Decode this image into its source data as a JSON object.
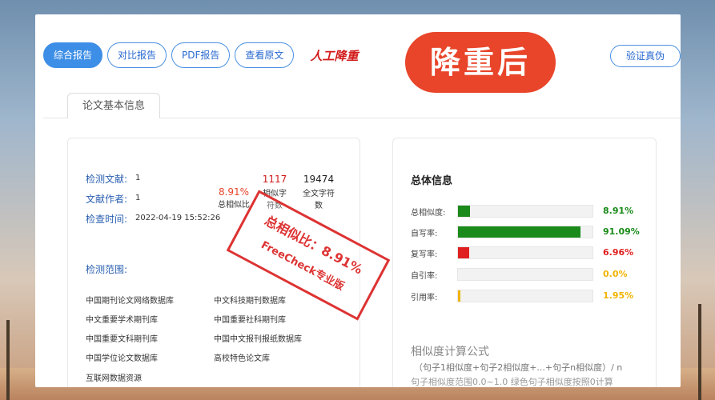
{
  "colors": {
    "accent": "#3d8ee6",
    "green": "#1a8a1a",
    "red": "#e02020",
    "orange": "#f0b400"
  },
  "toolbar": {
    "tabs": [
      {
        "label": "综合报告",
        "active": true
      },
      {
        "label": "对比报告",
        "active": false
      },
      {
        "label": "PDF报告",
        "active": false
      },
      {
        "label": "查看原文",
        "active": false
      }
    ],
    "manual_label": "人工降重",
    "verify_label": "验证真伪"
  },
  "overlay_text": "降重后",
  "section_tab": "论文基本信息",
  "basic": {
    "doc_label": "检测文献:",
    "doc_value": "1",
    "author_label": "文献作者:",
    "author_value": "1",
    "time_label": "检查时间:",
    "time_value": "2022-04-19 15:52:26",
    "similarity_value": "8.91%",
    "similarity_label": "总相似比",
    "similar_chars_value": "1117",
    "similar_chars_label": "相似字符数",
    "total_chars_value": "19474",
    "total_chars_label": "全文字符数"
  },
  "scope": {
    "title": "检测范围:",
    "databases": [
      "中国期刊论文网络数据库",
      "中文科技期刊数据库",
      "中文重要学术期刊库",
      "中国重要社科期刊库",
      "中国重要文科期刊库",
      "中国中文报刊报纸数据库",
      "中国学位论文数据库",
      "高校特色论文库",
      "互联网数据资源"
    ]
  },
  "stamp": {
    "line1": "总相似比：8.91%",
    "line2": "FreeCheck专业版"
  },
  "overall": {
    "title": "总体信息",
    "metrics": [
      {
        "label": "总相似度:",
        "value": "8.91%",
        "fraction": 0.0891,
        "color": "#1a8a1a"
      },
      {
        "label": "自写率:",
        "value": "91.09%",
        "fraction": 0.9109,
        "color": "#1a8a1a"
      },
      {
        "label": "复写率:",
        "value": "6.96%",
        "fraction": 0.0696,
        "color": "#e02020"
      },
      {
        "label": "自引率:",
        "value": "0.0%",
        "fraction": 0.0,
        "color": "#f0b400"
      },
      {
        "label": "引用率:",
        "value": "1.95%",
        "fraction": 0.0195,
        "color": "#f0b400"
      }
    ],
    "formula_title": "相似度计算公式",
    "formula_line1": "（句子1相似度+句子2相似度+...+句子n相似度）/ n",
    "formula_line2": "句子相似度范围0.0~1.0 绿色句子相似度按照0计算"
  }
}
